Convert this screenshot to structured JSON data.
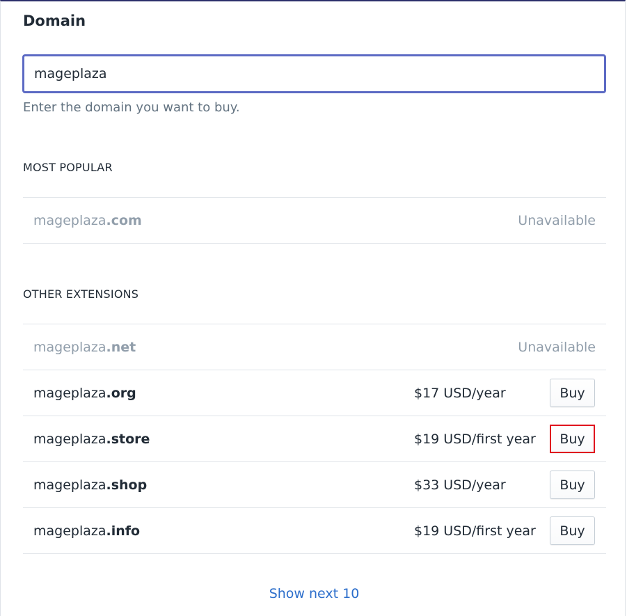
{
  "section": {
    "title": "Domain"
  },
  "search": {
    "value": "mageplaza",
    "help_text": "Enter the domain you want to buy."
  },
  "most_popular": {
    "heading": "MOST POPULAR",
    "items": [
      {
        "base": "mageplaza",
        "ext": ".com",
        "status": "Unavailable"
      }
    ]
  },
  "other_extensions": {
    "heading": "OTHER EXTENSIONS",
    "items": [
      {
        "base": "mageplaza",
        "ext": ".net",
        "status": "Unavailable"
      },
      {
        "base": "mageplaza",
        "ext": ".org",
        "price": "$17 USD/year",
        "button": "Buy"
      },
      {
        "base": "mageplaza",
        "ext": ".store",
        "price": "$19 USD/first year",
        "button": "Buy"
      },
      {
        "base": "mageplaza",
        "ext": ".shop",
        "price": "$33 USD/year",
        "button": "Buy"
      },
      {
        "base": "mageplaza",
        "ext": ".info",
        "price": "$19 USD/first year",
        "button": "Buy"
      }
    ]
  },
  "footer": {
    "show_next": "Show next 10"
  },
  "colors": {
    "input_focus_border": "#5c6ac4",
    "link": "#2c6ecb",
    "highlight_border": "#e0141e",
    "muted_text": "#919eab"
  }
}
